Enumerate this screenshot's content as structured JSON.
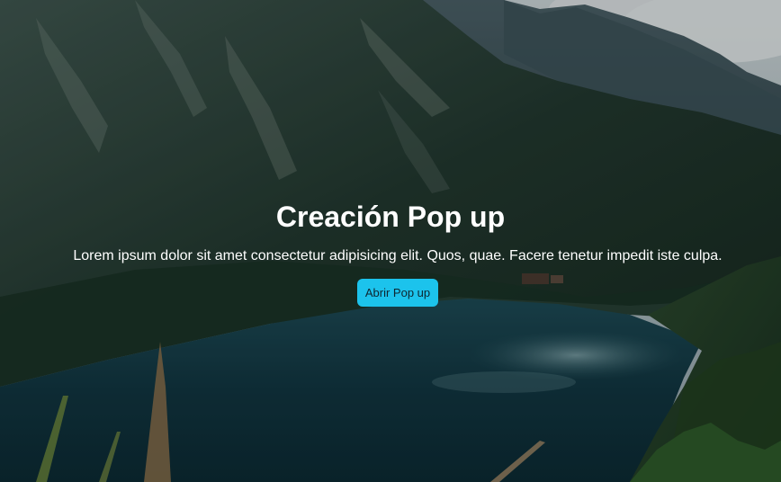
{
  "hero": {
    "title": "Creación Pop up",
    "text": "Lorem ipsum dolor sit amet consectetur adipisicing elit. Quos, quae. Facere tenetur impedit iste culpa.",
    "button_label": "Abrir Pop up"
  },
  "colors": {
    "button_bg": "#1cc3ec",
    "title_text": "#ffffff"
  }
}
